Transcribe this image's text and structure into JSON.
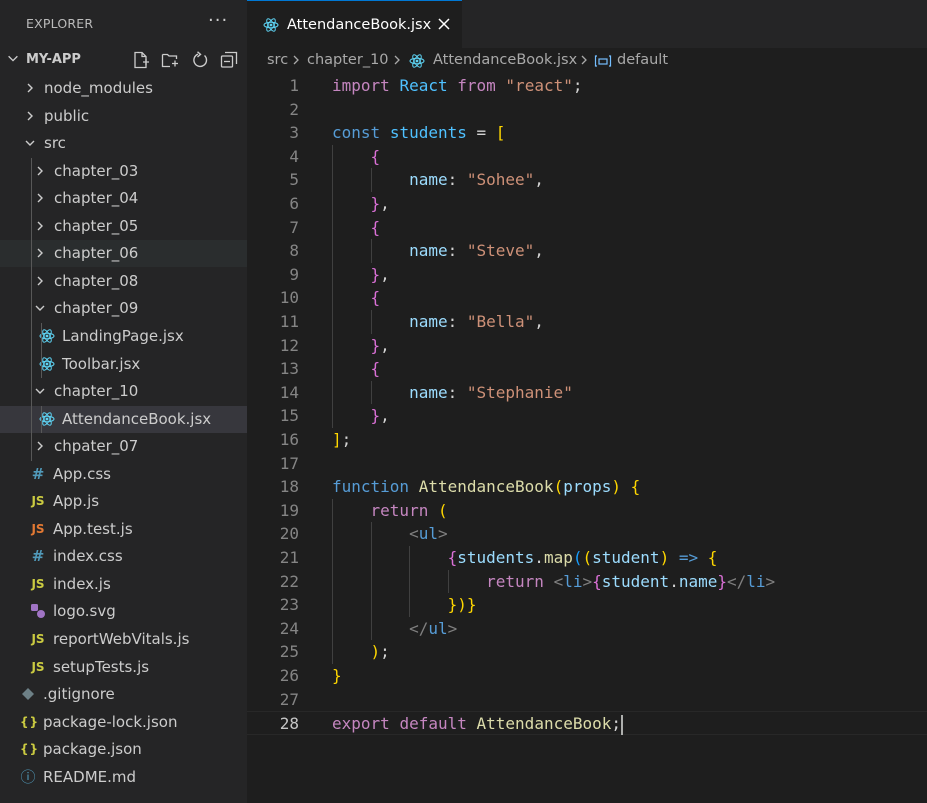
{
  "explorer": {
    "title": "EXPLORER",
    "more_label": "···",
    "project": "MY-APP",
    "actions": [
      "new-file-icon",
      "new-folder-icon",
      "refresh-icon",
      "collapse-all-icon"
    ],
    "tree": [
      {
        "label": "node_modules",
        "type": "folder"
      },
      {
        "label": "public",
        "type": "folder"
      },
      {
        "label": "src",
        "type": "folder-open"
      },
      {
        "label": "chapter_03",
        "type": "folder"
      },
      {
        "label": "chapter_04",
        "type": "folder"
      },
      {
        "label": "chapter_05",
        "type": "folder"
      },
      {
        "label": "chapter_06",
        "type": "folder"
      },
      {
        "label": "chapter_08",
        "type": "folder"
      },
      {
        "label": "chapter_09",
        "type": "folder-open"
      },
      {
        "label": "LandingPage.jsx",
        "type": "react"
      },
      {
        "label": "Toolbar.jsx",
        "type": "react"
      },
      {
        "label": "chapter_10",
        "type": "folder-open"
      },
      {
        "label": "AttendanceBook.jsx",
        "type": "react"
      },
      {
        "label": "chpater_07",
        "type": "folder"
      },
      {
        "label": "App.css",
        "type": "css",
        "glyph": "#"
      },
      {
        "label": "App.js",
        "type": "js",
        "glyph": "JS"
      },
      {
        "label": "App.test.js",
        "type": "test",
        "glyph": "JS"
      },
      {
        "label": "index.css",
        "type": "css",
        "glyph": "#"
      },
      {
        "label": "index.js",
        "type": "js",
        "glyph": "JS"
      },
      {
        "label": "logo.svg",
        "type": "svg"
      },
      {
        "label": "reportWebVitals.js",
        "type": "js",
        "glyph": "JS"
      },
      {
        "label": "setupTests.js",
        "type": "js",
        "glyph": "JS"
      },
      {
        "label": ".gitignore",
        "type": "git"
      },
      {
        "label": "package-lock.json",
        "type": "json",
        "glyph": "{}"
      },
      {
        "label": "package.json",
        "type": "json",
        "glyph": "{}"
      },
      {
        "label": "README.md",
        "type": "info",
        "glyph": "ⓘ"
      }
    ],
    "selected": "AttendanceBook.jsx",
    "hovered": "chapter_06"
  },
  "tab": {
    "label": "AttendanceBook.jsx",
    "close": "close-icon"
  },
  "breadcrumb": [
    "src",
    "chapter_10",
    "AttendanceBook.jsx",
    "default"
  ],
  "editor": {
    "current_line": 28,
    "lines": [
      "import React from \"react\";",
      "",
      "const students = [",
      "    {",
      "        name: \"Sohee\",",
      "    },",
      "    {",
      "        name: \"Steve\",",
      "    },",
      "    {",
      "        name: \"Bella\",",
      "    },",
      "    {",
      "        name: \"Stephanie\"",
      "    },",
      "];",
      "",
      "function AttendanceBook(props) {",
      "    return (",
      "        <ul>",
      "            {students.map((student) => {",
      "                return <li>{student.name}</li>",
      "            })}",
      "        </ul>",
      "    );",
      "}",
      "",
      "export default AttendanceBook;"
    ]
  }
}
